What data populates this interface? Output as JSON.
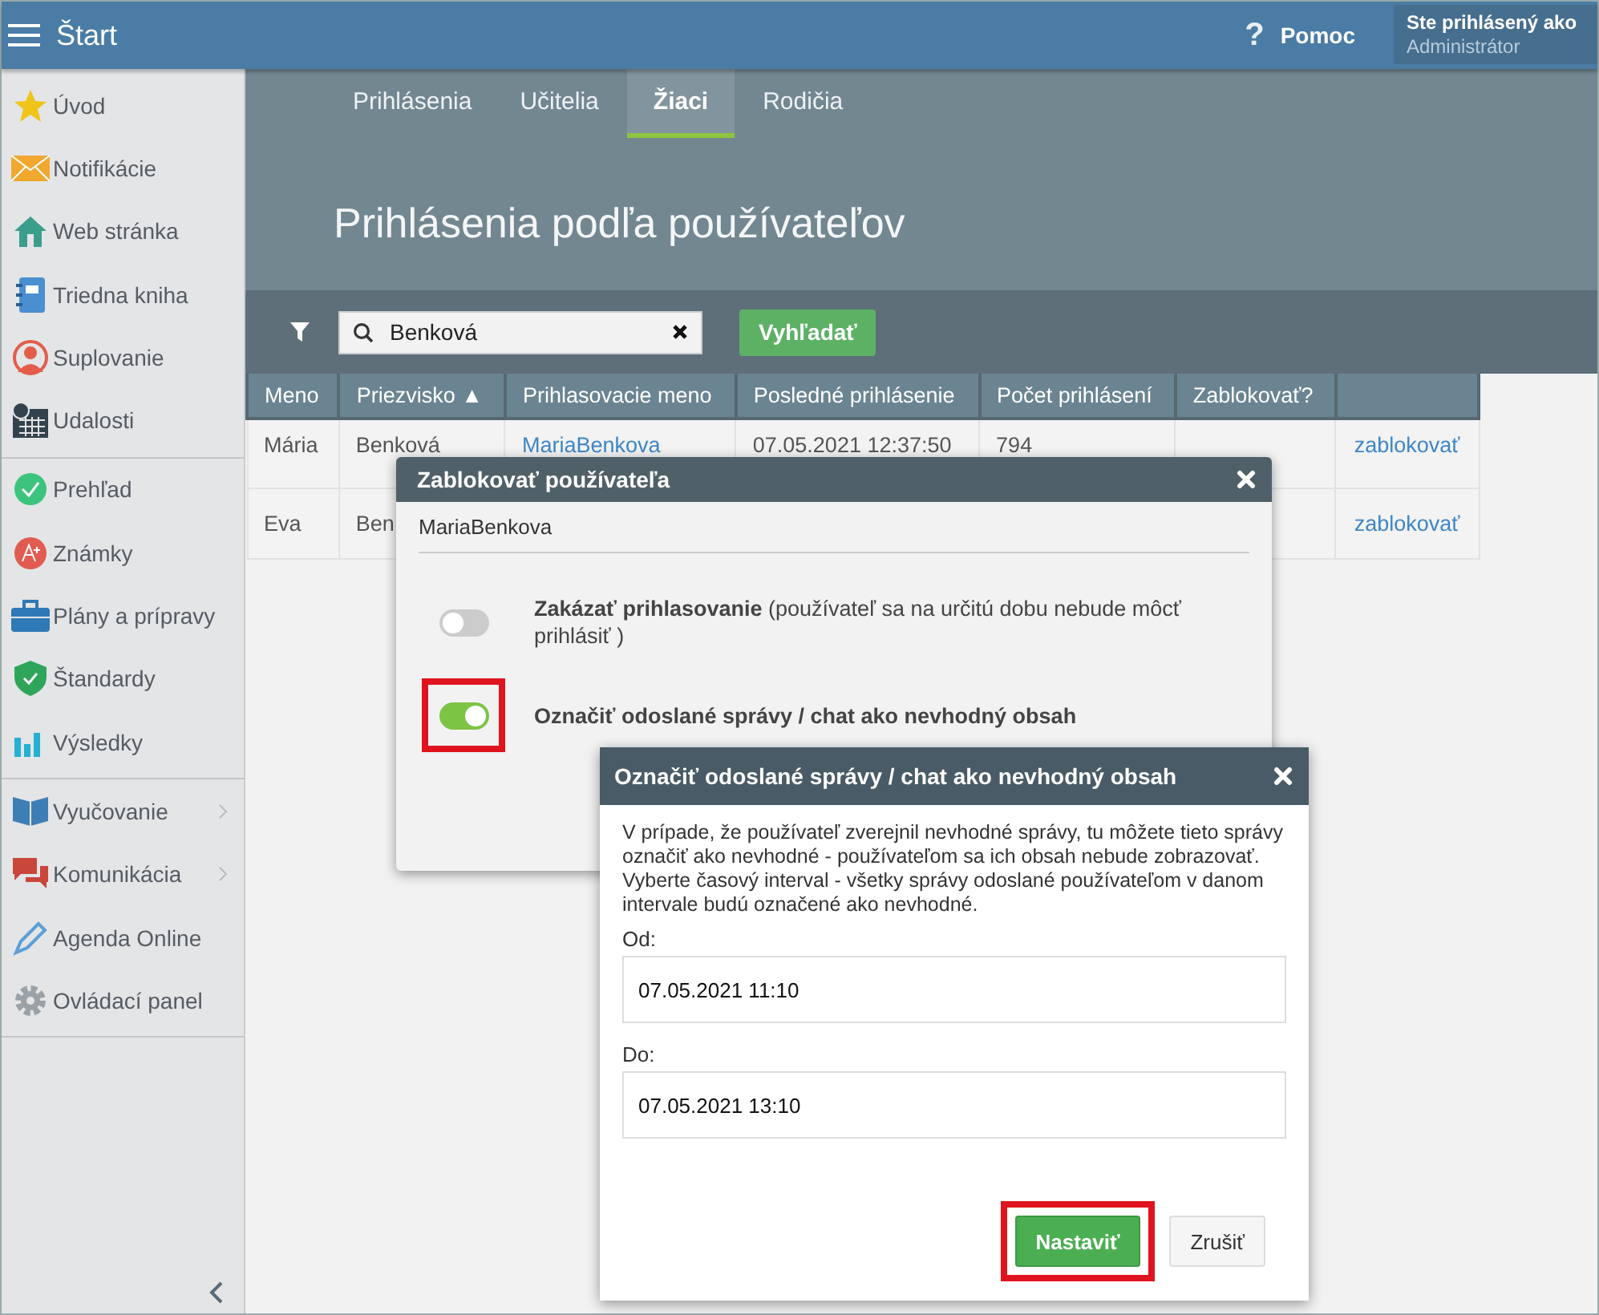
{
  "topbar": {
    "title": "Štart",
    "help_icon": "?",
    "help": "Pomoc",
    "user_label": "Ste prihlásený ako",
    "user_name": "Administrátor"
  },
  "sidebar": {
    "groups": [
      [
        {
          "label": "Úvod",
          "has_submenu": false
        },
        {
          "label": "Notifikácie",
          "has_submenu": false
        },
        {
          "label": "Web stránka",
          "has_submenu": false
        },
        {
          "label": "Triedna kniha",
          "has_submenu": false
        },
        {
          "label": "Suplovanie",
          "has_submenu": false
        },
        {
          "label": "Udalosti",
          "has_submenu": false
        }
      ],
      [
        {
          "label": "Prehľad",
          "has_submenu": false
        },
        {
          "label": "Známky",
          "has_submenu": false
        },
        {
          "label": "Plány a prípravy",
          "has_submenu": false
        },
        {
          "label": "Štandardy",
          "has_submenu": false
        },
        {
          "label": "Výsledky",
          "has_submenu": false
        }
      ],
      [
        {
          "label": "Vyučovanie",
          "has_submenu": true
        },
        {
          "label": "Komunikácia",
          "has_submenu": true
        },
        {
          "label": "Agenda Online",
          "has_submenu": false
        },
        {
          "label": "Ovládací panel",
          "has_submenu": false
        }
      ]
    ]
  },
  "tabs": [
    {
      "label": "Prihlásenia",
      "selected": false
    },
    {
      "label": "Učitelia",
      "selected": false
    },
    {
      "label": "Žiaci",
      "selected": true
    },
    {
      "label": "Rodičia",
      "selected": false
    }
  ],
  "page_title": "Prihlásenia podľa používateľov",
  "search": {
    "value": "Benková",
    "button": "Vyhľadať"
  },
  "table": {
    "columns": [
      "Meno",
      "Priezvisko ▲",
      "Prihlasovacie meno",
      "Posledné prihlásenie",
      "Počet prihlásení",
      "Zablokovať?"
    ],
    "rows": [
      {
        "first_name": "Mária",
        "last_name": "Benková",
        "username": "MariaBenkova",
        "last_login": "07.05.2021 12:37:50",
        "login_count": "794",
        "action": "zablokovať"
      },
      {
        "first_name": "Eva",
        "last_name": "Ben",
        "action": "zablokovať"
      }
    ]
  },
  "block_dialog": {
    "title": "Zablokovať používateľa",
    "username": "MariaBenkova",
    "options": [
      {
        "label": "**Zakázať prihlasovanie** (používateľ sa na určitú dobu nebude môcť prihlásiť )",
        "bold": false,
        "on": false,
        "highlighted": false
      },
      {
        "label": "Označiť odoslané správy / chat ako nevhodný obsah",
        "bold": true,
        "on": true,
        "highlighted": true
      }
    ]
  },
  "flag_dialog": {
    "title": "Označiť odoslané správy / chat ako nevhodný obsah",
    "text": "V prípade, že používateľ zverejnil nevhodné správy, tu môžete tieto správy označiť ako nevhodné - používateľom sa ich obsah nebude zobrazovať. Vyberte časový interval - všetky správy odoslané používateľom v danom intervale budú označené ako nevhodné.",
    "fields": [
      {
        "label": "Od:",
        "value": "07.05.2021 11:10"
      },
      {
        "label": "Do:",
        "value": "07.05.2021 13:10"
      }
    ],
    "buttons": [
      {
        "label": "Nastaviť",
        "kind": "primary",
        "highlighted": true
      },
      {
        "label": "Zrušiť",
        "kind": "secondary",
        "highlighted": false
      }
    ]
  }
}
